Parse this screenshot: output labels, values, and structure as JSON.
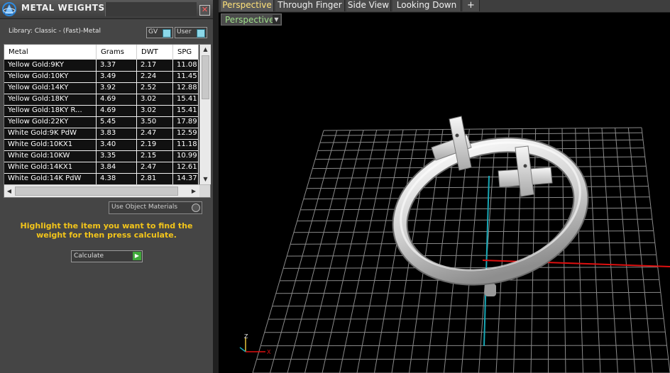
{
  "panel": {
    "title": "METAL WEIGHTS",
    "close_glyph": "✕",
    "library_label": "Library: Classic - (Fast)-Metal",
    "toggles": {
      "gv": "GV",
      "user": "User"
    },
    "table": {
      "headers": [
        "Metal",
        "Grams",
        "DWT",
        "SPG"
      ],
      "rows": [
        [
          "Yellow Gold:9KY",
          "3.37",
          "2.17",
          "11.08"
        ],
        [
          "Yellow Gold:10KY",
          "3.49",
          "2.24",
          "11.45"
        ],
        [
          "Yellow Gold:14KY",
          "3.92",
          "2.52",
          "12.88"
        ],
        [
          "Yellow Gold:18KY",
          "4.69",
          "3.02",
          "15.41"
        ],
        [
          "Yellow Gold:18KY R...",
          "4.69",
          "3.02",
          "15.41"
        ],
        [
          "Yellow Gold:22KY",
          "5.45",
          "3.50",
          "17.89"
        ],
        [
          "White Gold:9K PdW",
          "3.83",
          "2.47",
          "12.59"
        ],
        [
          "White Gold:10KX1",
          "3.40",
          "2.19",
          "11.18"
        ],
        [
          "White Gold:10KW",
          "3.35",
          "2.15",
          "10.99"
        ],
        [
          "White Gold:14KX1",
          "3.84",
          "2.47",
          "12.61"
        ],
        [
          "White Gold:14K PdW",
          "4.38",
          "2.81",
          "14.37"
        ]
      ]
    },
    "use_object_materials": "Use Object Materials",
    "instructions": "Highlight the item you want to find the weight for then press calculate.",
    "calculate_label": "Calculate"
  },
  "viewport": {
    "tabs": [
      "Perspective",
      "Through Finger",
      "Side View",
      "Looking Down"
    ],
    "active_tab": 0,
    "add_tab_glyph": "+",
    "view_mode": "Perspective",
    "axis_labels": {
      "z": "Z",
      "x": "X"
    },
    "colors": {
      "background": "#000000",
      "grid": "#8a8a8a",
      "x_axis": "#e01010",
      "y_axis": "#18a7b5",
      "ring": "#d9d9d9",
      "accent_text": "#f3c51a"
    }
  }
}
